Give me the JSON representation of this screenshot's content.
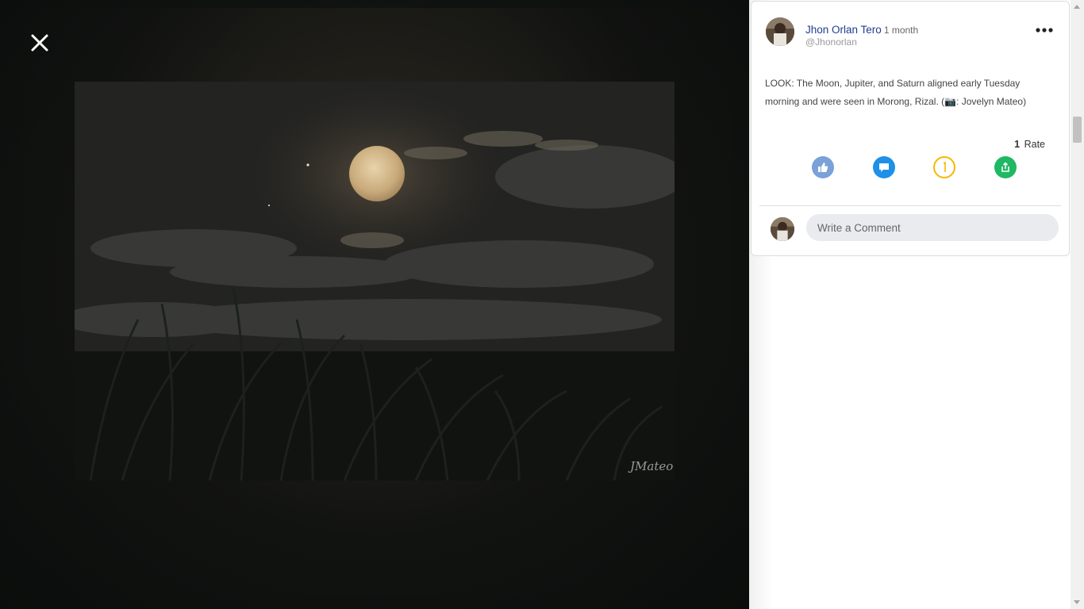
{
  "viewer": {
    "close_icon": "close-icon",
    "photo_signature": "JMateo"
  },
  "post": {
    "author_name": "Jhon Orlan Tero",
    "time": "1 month",
    "handle": "@Jhonorlan",
    "more_icon": "more-options-icon",
    "text": "LOOK: The Moon, Jupiter, and Saturn aligned early Tuesday morning and were seen in Morong, Rizal. (📷: Jovelyn Mateo)",
    "rate_count": "1",
    "rate_label": "Rate",
    "actions": [
      {
        "icon": "thumbs-up-icon",
        "color": "#7aa1d8"
      },
      {
        "icon": "comment-icon",
        "color": "#1e90e8"
      },
      {
        "icon": "rate-icon",
        "color": "#f5b800"
      },
      {
        "icon": "share-icon",
        "color": "#1fb863"
      }
    ]
  },
  "comment": {
    "placeholder": "Write a Comment"
  }
}
